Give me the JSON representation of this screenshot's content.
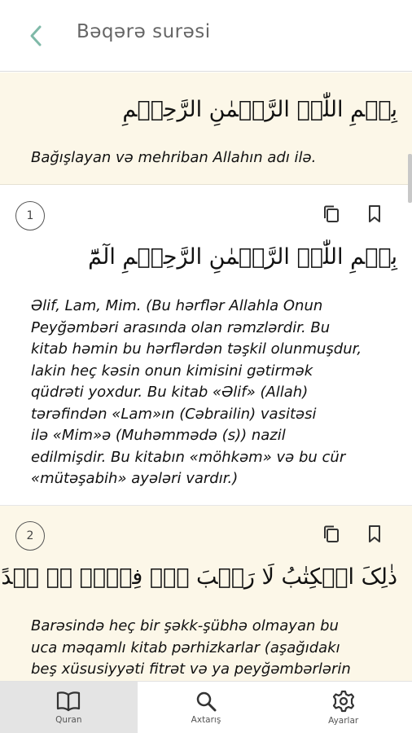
{
  "header": {
    "title": "Bəqərə surəsi"
  },
  "bismillah": {
    "arabic": "بِسۡمِ اللّٰہِ الرَّحۡمٰنِ الرَّحِیۡمِ",
    "translation": "Bağışlayan və mehriban Allahın adı ilə."
  },
  "ayahs": [
    {
      "number": "1",
      "arabic": "بِسۡمِ اللّٰہِ الرَّحۡمٰنِ الرَّحِیۡمِ الٓمّٓ",
      "lines": [
        "Əlif, Lam, Mim. (Bu hərflər Allahla Onun",
        "Peyğəmbəri arasında olan rəmzlərdir. Bu",
        "kitab həmin bu hərflərdən təşkil olunmuşdur,",
        "lakin heç kəsin onun kimisini gətirmək",
        "qüdrəti yoxdur. Bu kitab «Əlif» (Allah)",
        "tərəfindən «Lam»ın (Cəbrailin) vasitəsi",
        "ilə «Mim»ə (Muhəmmədə (s)) nazil",
        "edilmişdir. Bu kitabın «möhkəm» və bu cür",
        "«mütəşabih» ayələri vardır.)"
      ]
    },
    {
      "number": "2",
      "arabic": "ذٰلِکَ الۡکِتٰبُ لَا رَیۡبَ ۚۖۛ فِیۡہِ ۚۛ ہُدًی لِّلۡمُتَّقِیۡنَ",
      "lines": [
        "Barəsində heç bir şəkk-şübhə olmayan bu",
        "uca məqamlı kitab pərhizkarlar (aşağıdakı",
        "beş xüsusiyyəti fitrət və ya peyğəmbərlərin"
      ]
    }
  ],
  "nav": {
    "items": [
      {
        "label": "Quran",
        "icon": "book-icon",
        "active": true
      },
      {
        "label": "Axtarış",
        "icon": "search-icon",
        "active": false
      },
      {
        "label": "Ayarlar",
        "icon": "gear-icon",
        "active": false
      }
    ]
  },
  "colors": {
    "accent": "#7fb9a8",
    "cream": "#fcf7e8",
    "navActive": "#e4e4e4"
  }
}
